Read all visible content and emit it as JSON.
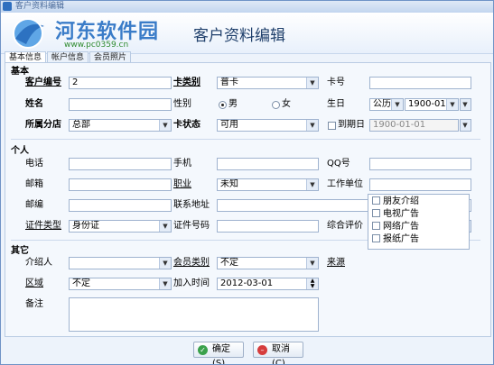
{
  "window": {
    "title": "客户资料编辑"
  },
  "header": {
    "site_name": "河东软件园",
    "site_url": "www.pc0359.cn",
    "dialog_title": "客户资料编辑"
  },
  "tabs": [
    {
      "label": "基本信息"
    },
    {
      "label": "帐户信息"
    },
    {
      "label": "会员照片"
    }
  ],
  "basic": {
    "section": "基本",
    "customer_no_label": "客户编号",
    "customer_no_value": "2",
    "card_type_label": "卡类别",
    "card_type_value": "普卡",
    "card_no_label": "卡号",
    "card_no_value": "",
    "name_label": "姓名",
    "name_value": "",
    "gender_label": "性别",
    "gender_male": "男",
    "gender_female": "女",
    "gender_selected": "男",
    "birthday_label": "生日",
    "calendar_value": "公历",
    "birthday_value": "1900-01-01",
    "branch_label": "所属分店",
    "branch_value": "总部",
    "card_status_label": "卡状态",
    "card_status_value": "可用",
    "expiry_label": "到期日",
    "expiry_value": "1900-01-01"
  },
  "personal": {
    "section": "个人",
    "phone_label": "电话",
    "mobile_label": "手机",
    "qq_label": "QQ号",
    "email_label": "邮箱",
    "job_label": "职业",
    "job_value": "未知",
    "work_label": "工作单位",
    "zip_label": "邮编",
    "address_label": "联系地址",
    "id_type_label": "证件类型",
    "id_type_value": "身份证",
    "id_no_label": "证件号码",
    "rating_label": "综合评价",
    "rating_value": "☆"
  },
  "other": {
    "section": "其它",
    "referrer_label": "介绍人",
    "member_type_label": "会员类别",
    "member_type_value": "不定",
    "source_label": "来源",
    "sources": [
      {
        "label": "朋友介绍"
      },
      {
        "label": "电视广告"
      },
      {
        "label": "网络广告"
      },
      {
        "label": "报纸广告"
      }
    ],
    "region_label": "区域",
    "region_value": "不定",
    "join_time_label": "加入时间",
    "join_time_value": "2012-03-01",
    "note_label": "备注"
  },
  "buttons": {
    "ok": "确定(S)",
    "cancel": "取消(C)"
  },
  "colors": {
    "brand_blue": "#3a7cc8",
    "ok_green": "#3aa14b",
    "cancel_red": "#d63c3c"
  }
}
